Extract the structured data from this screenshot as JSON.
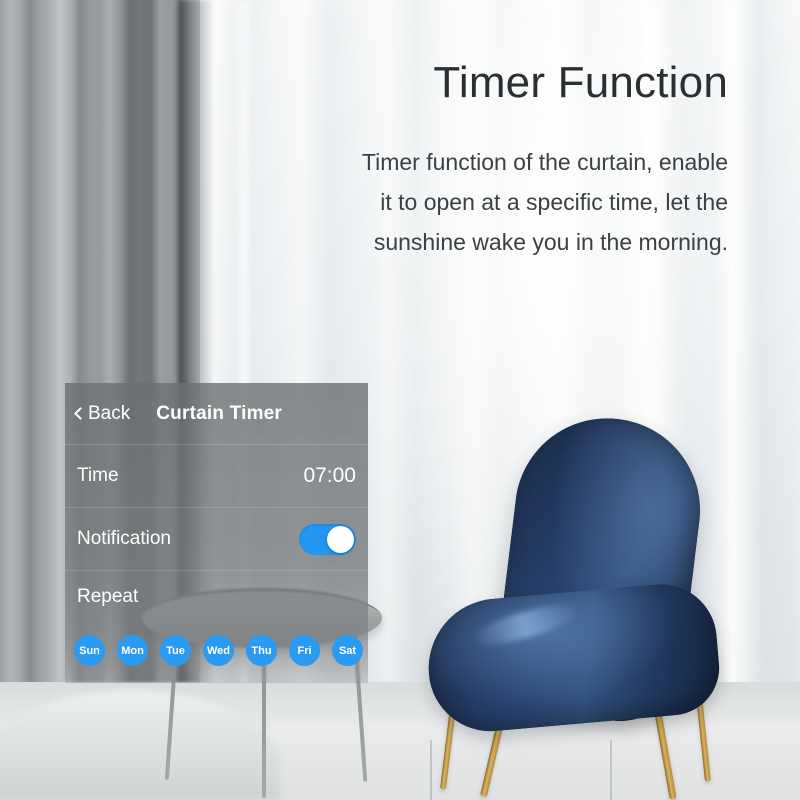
{
  "marketing": {
    "headline": "Timer Function",
    "subcopy": "Timer function of the curtain, enable it to open at a specific time, let the sunshine wake you in the morning."
  },
  "panel": {
    "header": {
      "back_label": "Back",
      "back_icon": "chevron-left-icon",
      "title": "Curtain Timer"
    },
    "rows": [
      {
        "label": "Time",
        "value": "07:00"
      },
      {
        "label": "Notification",
        "toggle": "on"
      },
      {
        "label": "Repeat"
      }
    ],
    "time_row": {
      "label": "Time",
      "value": "07:00"
    },
    "notification_row": {
      "label": "Notification",
      "toggle_state": "on"
    },
    "repeat_row": {
      "label": "Repeat"
    },
    "days": [
      {
        "label": "Sun",
        "selected": true
      },
      {
        "label": "Mon",
        "selected": true
      },
      {
        "label": "Tue",
        "selected": true
      },
      {
        "label": "Wed",
        "selected": true
      },
      {
        "label": "Thu",
        "selected": true
      },
      {
        "label": "Fri",
        "selected": true
      },
      {
        "label": "Sat",
        "selected": true
      }
    ]
  },
  "colors": {
    "toggle_on": "#2196f3",
    "day_pill": "#2a9bf0",
    "panel_overlay": "#6c6f71",
    "headline_text": "#2c2f31",
    "chair_navy": "#1d3154",
    "chair_legs_gold": "#d7b362"
  }
}
